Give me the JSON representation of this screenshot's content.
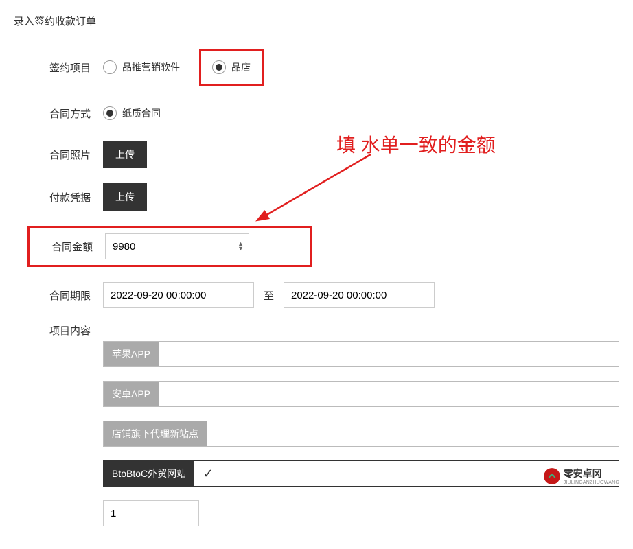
{
  "pageTitle": "录入签约收款订单",
  "labels": {
    "signedProject": "签约项目",
    "contractMethod": "合同方式",
    "contractPhoto": "合同照片",
    "paymentProof": "付款凭据",
    "contractAmount": "合同金额",
    "contractPeriod": "合同期限",
    "projectContent": "项目内容"
  },
  "radios": {
    "software": "品推营销软件",
    "shop": "品店",
    "paper": "纸质合同"
  },
  "buttons": {
    "upload": "上传"
  },
  "amountValue": "9980",
  "dateFrom": "2022-09-20 00:00:00",
  "dateTo": "2022-09-20 00:00:00",
  "dateSeparator": "至",
  "tags": {
    "appleApp": "苹果APP",
    "androidApp": "安卓APP",
    "proxySite": "店铺旗下代理新站点",
    "btobtoc": "BtoBtoC外贸网站"
  },
  "countValue": "1",
  "annotationText": "填 水单一致的金额",
  "watermark": {
    "cn": "零安卓冈",
    "py": "JIULINGANZHUOWANG"
  },
  "checkMark": "✓"
}
